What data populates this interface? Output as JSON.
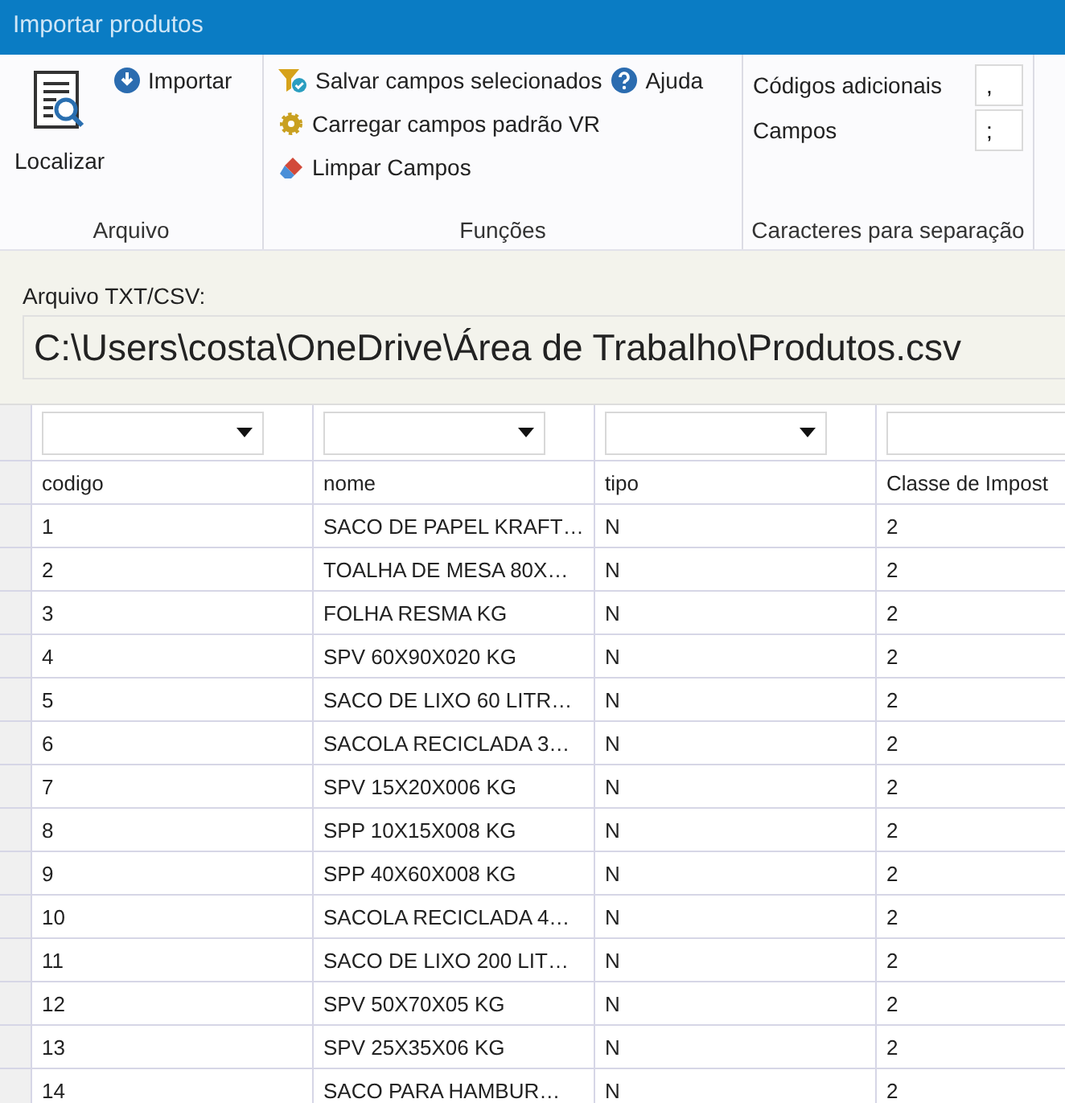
{
  "window": {
    "title": "Importar produtos"
  },
  "ribbon": {
    "groups": [
      {
        "label": "Arquivo",
        "items": [
          {
            "kind": "large",
            "label": "Localizar"
          },
          {
            "kind": "small",
            "label": "Importar"
          }
        ]
      },
      {
        "label": "Funções",
        "items": [
          {
            "kind": "small",
            "label": "Salvar campos selecionados"
          },
          {
            "kind": "small",
            "label": "Carregar campos padrão VR"
          },
          {
            "kind": "small",
            "label": "Limpar Campos"
          },
          {
            "kind": "small",
            "label": "Ajuda"
          }
        ]
      },
      {
        "label": "Caracteres para separação",
        "items": [
          {
            "kind": "field",
            "label": "Códigos adicionais",
            "value": ","
          },
          {
            "kind": "field",
            "label": "Campos",
            "value": ";"
          }
        ]
      }
    ]
  },
  "file": {
    "label": "Arquivo TXT/CSV:",
    "value": "C:\\Users\\costa\\OneDrive\\Área de Trabalho\\Produtos.csv"
  },
  "table": {
    "columns": [
      "codigo",
      "nome",
      "tipo",
      "Classe de Impost"
    ],
    "rows": [
      [
        "1",
        "SACO DE PAPEL KRAFT…",
        "N",
        "2"
      ],
      [
        "2",
        "TOALHA DE MESA 80X…",
        "N",
        "2"
      ],
      [
        "3",
        "FOLHA RESMA KG",
        "N",
        "2"
      ],
      [
        "4",
        "SPV 60X90X020 KG",
        "N",
        "2"
      ],
      [
        "5",
        "SACO DE LIXO 60 LITR…",
        "N",
        "2"
      ],
      [
        "6",
        "SACOLA RECICLADA 3…",
        "N",
        "2"
      ],
      [
        "7",
        "SPV 15X20X006 KG",
        "N",
        "2"
      ],
      [
        "8",
        "SPP 10X15X008 KG",
        "N",
        "2"
      ],
      [
        "9",
        "SPP 40X60X008 KG",
        "N",
        "2"
      ],
      [
        "10",
        "SACOLA RECICLADA 4…",
        "N",
        "2"
      ],
      [
        "11",
        "SACO DE LIXO 200 LIT…",
        "N",
        "2"
      ],
      [
        "12",
        "SPV 50X70X05 KG",
        "N",
        "2"
      ],
      [
        "13",
        "SPV 25X35X06 KG",
        "N",
        "2"
      ],
      [
        "14",
        "SACO PARA HAMBUR…",
        "N",
        "2"
      ]
    ]
  }
}
